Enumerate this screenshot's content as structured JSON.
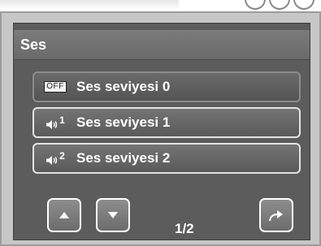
{
  "menu": {
    "title": "Ses"
  },
  "options": [
    {
      "badge": "OFF",
      "label": "Ses seviyesi 0",
      "selected": true
    },
    {
      "level": "1",
      "label": "Ses seviyesi 1",
      "selected": false
    },
    {
      "level": "2",
      "label": "Ses seviyesi 2",
      "selected": false
    }
  ],
  "pager": {
    "page": "1/2"
  },
  "icons": {
    "up": "arrow-up-icon",
    "down": "arrow-down-icon",
    "return": "return-arrow-icon",
    "speaker": "speaker-icon"
  },
  "colors": {
    "screen": "#5c5c5c",
    "title_bar": "#6f6f6f",
    "frame": "#c7c7c7",
    "text": "#ffffff"
  }
}
